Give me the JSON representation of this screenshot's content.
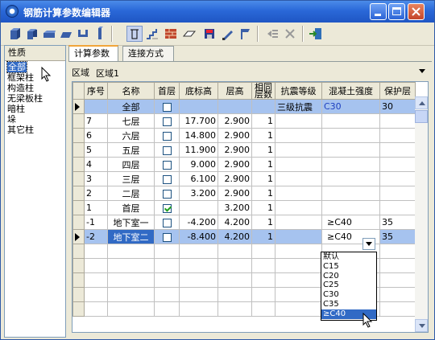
{
  "window": {
    "title": "钢筋计算参数编辑器"
  },
  "left_panel": {
    "header": "性质",
    "items": [
      "全部",
      "框架柱",
      "构造柱",
      "无梁板柱",
      "暗柱",
      "垛",
      "其它柱"
    ],
    "selected": "全部"
  },
  "tabs": [
    "计算参数",
    "连接方式"
  ],
  "region": {
    "label": "区域",
    "value": "区域1"
  },
  "grid": {
    "columns": [
      "序号",
      "名称",
      "首层",
      "底标高",
      "层高",
      "相同层数",
      "抗震等级",
      "混凝土强度",
      "保护层"
    ],
    "rows": [
      {
        "marker": "▶",
        "seq": "",
        "name": "全部",
        "first": false,
        "bottom": "",
        "height": "",
        "same": "",
        "seismic": "三级抗震",
        "concrete": "C30",
        "cover": "30",
        "highlight": true
      },
      {
        "marker": "",
        "seq": "7",
        "name": "七层",
        "first": false,
        "bottom": "17.700",
        "height": "2.900",
        "same": "1",
        "seismic": "",
        "concrete": "",
        "cover": ""
      },
      {
        "marker": "",
        "seq": "6",
        "name": "六层",
        "first": false,
        "bottom": "14.800",
        "height": "2.900",
        "same": "1",
        "seismic": "",
        "concrete": "",
        "cover": ""
      },
      {
        "marker": "",
        "seq": "5",
        "name": "五层",
        "first": false,
        "bottom": "11.900",
        "height": "2.900",
        "same": "1",
        "seismic": "",
        "concrete": "",
        "cover": ""
      },
      {
        "marker": "",
        "seq": "4",
        "name": "四层",
        "first": false,
        "bottom": "9.000",
        "height": "2.900",
        "same": "1",
        "seismic": "",
        "concrete": "",
        "cover": ""
      },
      {
        "marker": "",
        "seq": "3",
        "name": "三层",
        "first": false,
        "bottom": "6.100",
        "height": "2.900",
        "same": "1",
        "seismic": "",
        "concrete": "",
        "cover": ""
      },
      {
        "marker": "",
        "seq": "2",
        "name": "二层",
        "first": false,
        "bottom": "3.200",
        "height": "2.900",
        "same": "1",
        "seismic": "",
        "concrete": "",
        "cover": ""
      },
      {
        "marker": "",
        "seq": "1",
        "name": "首层",
        "first": true,
        "bottom": "",
        "height": "3.200",
        "same": "1",
        "seismic": "",
        "concrete": "",
        "cover": ""
      },
      {
        "marker": "",
        "seq": "-1",
        "name": "地下室一",
        "first": false,
        "bottom": "-4.200",
        "height": "4.200",
        "same": "1",
        "seismic": "",
        "concrete": "≥C40",
        "cover": "35"
      },
      {
        "marker": "▶",
        "seq": "-2",
        "name": "地下室二",
        "first": false,
        "bottom": "-8.400",
        "height": "4.200",
        "same": "1",
        "seismic": "",
        "concrete": "≥C40",
        "cover": "35",
        "highlight": true,
        "editing": true
      }
    ],
    "empty_rows": 5
  },
  "dropdown": {
    "options": [
      "默认",
      "C15",
      "C20",
      "C25",
      "C30",
      "C35",
      "≥C40"
    ],
    "selected": "≥C40"
  },
  "toolbar": {
    "icons": [
      "column-icon-1",
      "column-icon-2",
      "column-icon-3",
      "column-icon-4",
      "column-icon-5",
      "column-icon-6",
      "column-select-icon",
      "stair-icon",
      "brick-wall-icon",
      "slab-icon",
      "save-icon",
      "pencil-icon",
      "flag-icon",
      "insert-icon",
      "delete-icon",
      "exit-icon"
    ]
  },
  "colors": {
    "accent": "#316ac5",
    "row_highlight": "#a6c3ef",
    "titlebar": "#2a68d8"
  }
}
